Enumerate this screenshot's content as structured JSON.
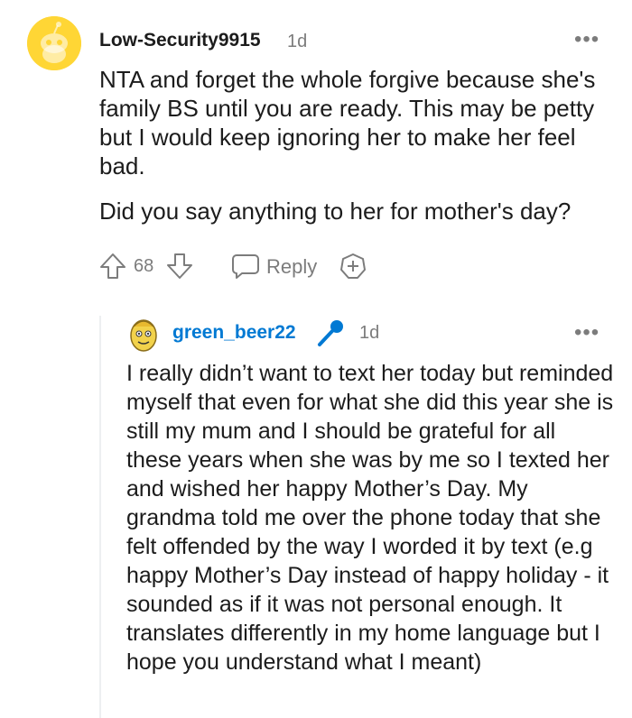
{
  "comment": {
    "author": "Low-Security9915",
    "time": "1d",
    "more": "•••",
    "paragraphs": [
      "NTA and forget the whole forgive because she's family BS until you are ready. This may be petty but I would keep ignoring her to make her feel bad.",
      "Did you say anything to her for mother's day?"
    ],
    "votes": "68",
    "reply_label": "Reply",
    "avatar_color": "#FFD635"
  },
  "reply": {
    "author": "green_beer22",
    "time": "1d",
    "more": "•••",
    "author_color": "#0079d3",
    "flair_icon": "microphone-icon",
    "body": "I really didn’t want to text her today but reminded myself that even for what she did this year she is still my mum and I should be grateful for all these years when she was by me so I texted her and wished her happy Mother’s Day. My grandma told me over the phone today that she felt offended by the way I worded it by text (e.g happy Mother’s Day instead of happy holiday - it sounded as if it was not personal enough. It translates differently in my home language but I hope you understand what I meant)"
  }
}
